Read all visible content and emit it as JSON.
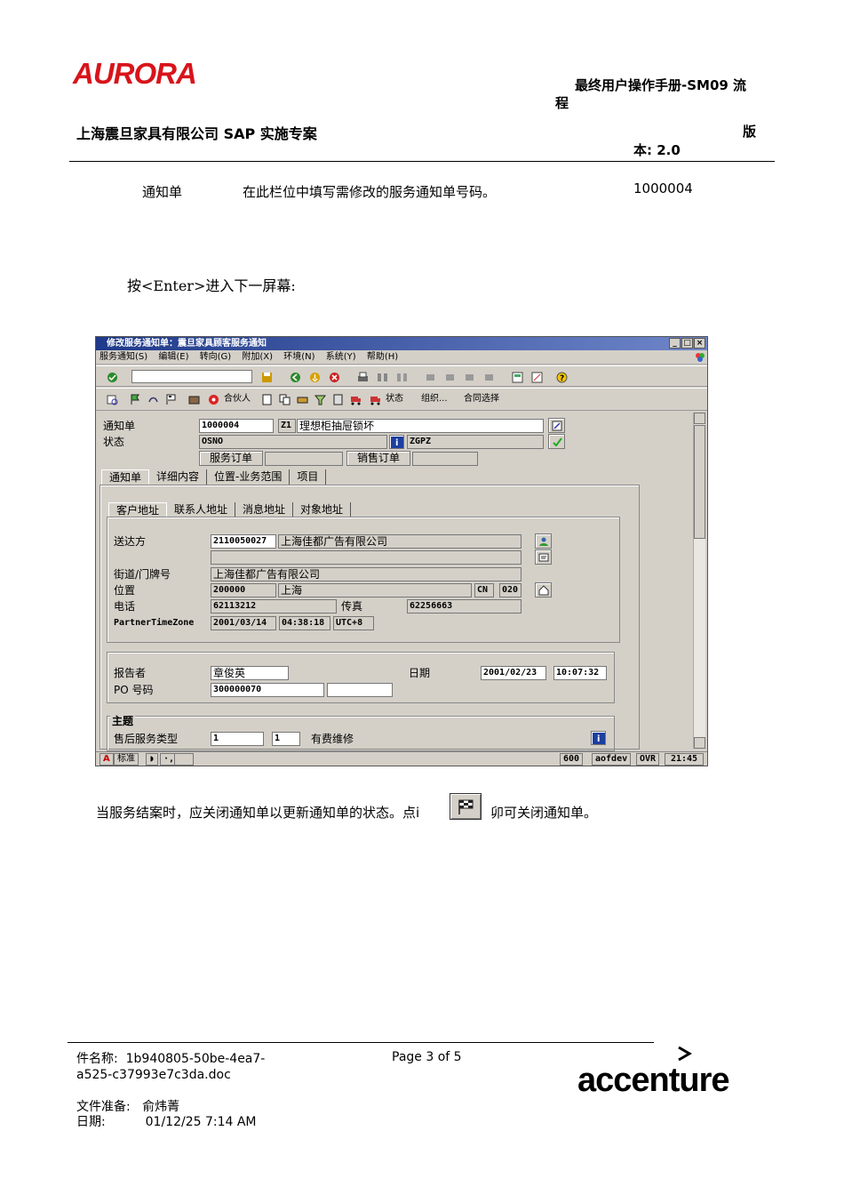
{
  "header": {
    "logo_text": "AURORA",
    "doc_title_line1": "最终用户操作手册-SM09 流",
    "doc_title_line2": "程",
    "company": "上海震旦家具有限公司 SAP 实施专案",
    "version_line1": "版",
    "version_line2": "本: 2.0"
  },
  "field_row": {
    "label": "通知单",
    "description": "在此栏位中填写需修改的服务通知单号码。",
    "value": "1000004"
  },
  "instruction": "按<Enter>进入下一屏幕:",
  "sap": {
    "window_title": "修改服务通知单：震旦家具顾客服务通知",
    "menu": [
      "服务通知(S)",
      "编辑(E)",
      "转向(G)",
      "附加(X)",
      "环境(N)",
      "系统(Y)",
      "帮助(H)"
    ],
    "app_toolbar": {
      "partner": "合伙人",
      "status": "状态",
      "org": "组织...",
      "contract": "合同选择"
    },
    "notification_label": "通知单",
    "notification_no": "1000004",
    "notification_type": "Z1",
    "notification_desc": "理想柜抽屉锁坏",
    "status_label": "状态",
    "status_value": "OSNO",
    "status_profile": "ZGPZ",
    "service_order_btn": "服务订单",
    "sales_order_btn": "销售订单",
    "main_tabs": [
      "通知单",
      "详细内容",
      "位置-业务范围",
      "项目"
    ],
    "sub_tabs": [
      "客户地址",
      "联系人地址",
      "消息地址",
      "对象地址"
    ],
    "ship_to_label": "送达方",
    "ship_to_no": "2110050027",
    "ship_to_name": "上海佳都广告有限公司",
    "street_label": "街道/门牌号",
    "street_value": "上海佳都广告有限公司",
    "location_label": "位置",
    "postal_code": "200000",
    "city": "上海",
    "country": "CN",
    "region": "020",
    "phone_label": "电话",
    "phone": "62113212",
    "fax_label": "传真",
    "fax": "62256663",
    "tz_label": "PartnerTimeZone",
    "tz_date": "2001/03/14",
    "tz_time": "04:38:18",
    "tz_zone": "UTC+8",
    "reporter_label": "报告者",
    "reporter": "章俊英",
    "date_label": "日期",
    "date": "2001/02/23",
    "time": "10:07:32",
    "po_label": "PO 号码",
    "po_no": "300000070",
    "subject_label": "主题",
    "aftersale_label": "售后服务类型",
    "aftersale_code1": "1",
    "aftersale_code2": "1",
    "aftersale_desc": "有费维修",
    "status_bar": {
      "mode": "标准",
      "client": "600",
      "system": "aofdev",
      "ovr": "OVR",
      "clock": "21:45"
    }
  },
  "closing_text": "当服务结案时，应关闭通知单以更新通知单的状态。点i",
  "closing_text_tail": "卯可关闭通知单。",
  "footer": {
    "file_label": "件名称:",
    "file_name_1": "1b940805-50be-4ea7-",
    "file_name_2": "a525-c37993e7c3da.doc",
    "page": "Page 3 of 5",
    "prepared_label": "文件准备:",
    "prepared_by": "俞炜菁",
    "date_label": "日期:",
    "date_value": "01/12/25 7:14 AM",
    "accenture_logo": "accenture"
  },
  "colors": {
    "aurora_red": "#d8141b",
    "sap_gray": "#d4d0c8",
    "sap_title_blue": "#1f3a8a"
  }
}
